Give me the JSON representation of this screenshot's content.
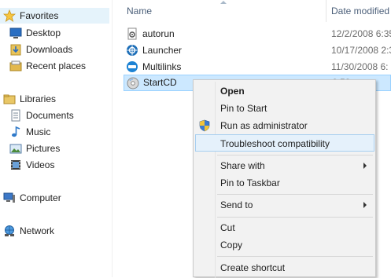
{
  "nav": {
    "favorites": "Favorites",
    "desktop": "Desktop",
    "downloads": "Downloads",
    "recent": "Recent places",
    "libraries": "Libraries",
    "documents": "Documents",
    "music": "Music",
    "pictures": "Pictures",
    "videos": "Videos",
    "computer": "Computer",
    "network": "Network"
  },
  "columns": {
    "name": "Name",
    "date": "Date modified"
  },
  "files": [
    {
      "name": "autorun",
      "date": "12/2/2008 6:35"
    },
    {
      "name": "Launcher",
      "date": "10/17/2008 2:3"
    },
    {
      "name": "Multilinks",
      "date": "11/30/2008 6:"
    },
    {
      "name": "StartCD",
      "date": "6:58"
    }
  ],
  "menu": {
    "open": "Open",
    "pin_start": "Pin to Start",
    "run_admin": "Run as administrator",
    "troubleshoot": "Troubleshoot compatibility",
    "share_with": "Share with",
    "pin_taskbar": "Pin to Taskbar",
    "send_to": "Send to",
    "cut": "Cut",
    "copy": "Copy",
    "create_shortcut": "Create shortcut"
  }
}
